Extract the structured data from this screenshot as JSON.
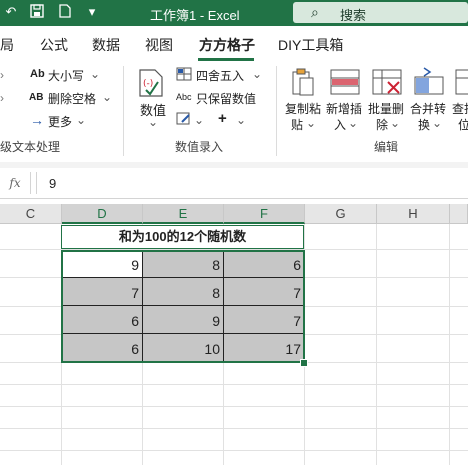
{
  "titlebar": {
    "title": "工作簿1  -  Excel",
    "search_placeholder": "搜索"
  },
  "tabs": [
    {
      "label": "局"
    },
    {
      "label": "公式"
    },
    {
      "label": "数据"
    },
    {
      "label": "视图"
    },
    {
      "label": "方方格子",
      "active": true
    },
    {
      "label": "DIY工具箱"
    }
  ],
  "ribbon": {
    "text_group": {
      "items": [
        "大小写",
        "删除空格",
        "更多"
      ],
      "icons": [
        "Ab",
        "AB"
      ],
      "label": "级文本处理"
    },
    "number_group": {
      "big_button": "数值",
      "items": [
        "四舍五入",
        "只保留数值"
      ],
      "small_icon_label": "Abc",
      "label": "数值录入"
    },
    "edit_group": {
      "buttons": [
        {
          "line1": "复制粘",
          "line2": "贴"
        },
        {
          "line1": "新增插",
          "line2": "入"
        },
        {
          "line1": "批量删",
          "line2": "除"
        },
        {
          "line1": "合并转",
          "line2": "换"
        },
        {
          "line1": "查找",
          "line2": "位"
        }
      ],
      "label": "编辑"
    }
  },
  "formula_bar": {
    "fx": "fx",
    "value": "9"
  },
  "columns": [
    "C",
    "D",
    "E",
    "F",
    "G",
    "H"
  ],
  "sheet": {
    "title": "和为100的12个随机数",
    "rows": [
      [
        "9",
        "8",
        "6"
      ],
      [
        "7",
        "8",
        "7"
      ],
      [
        "6",
        "9",
        "7"
      ],
      [
        "6",
        "10",
        "17"
      ]
    ]
  },
  "colors": {
    "accent": "#217346",
    "cell_fill": "#c6c6c6"
  }
}
